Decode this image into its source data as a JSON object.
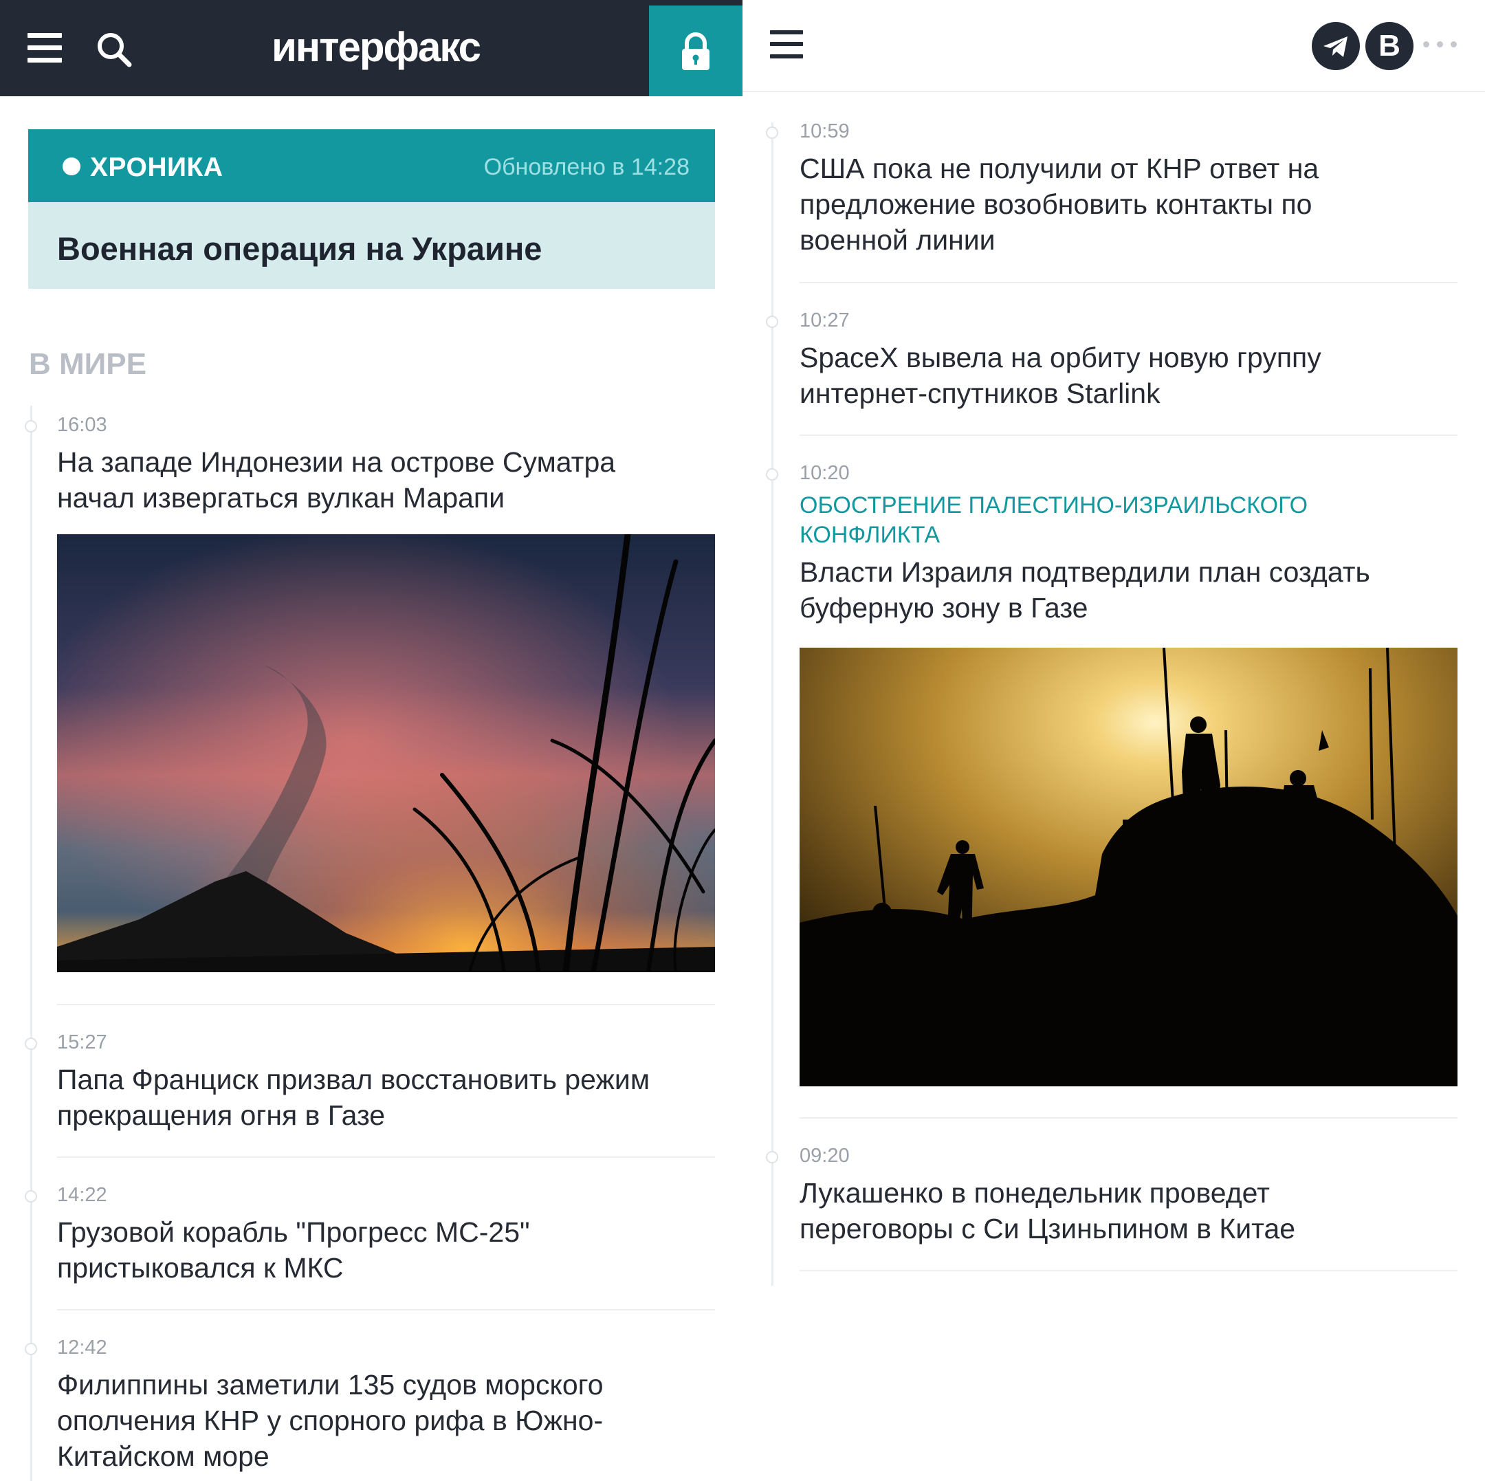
{
  "left": {
    "header": {
      "logo_text": "интерфакс",
      "menu_icon": "hamburger-menu-icon",
      "search_icon": "search-icon",
      "lock_icon": "lock-icon",
      "bg_color": "#232a36",
      "accent_color": "#14989f"
    },
    "chronicle": {
      "label": "ХРОНИКА",
      "updated": "Обновлено в 14:28",
      "title": "Военная операция на Украине"
    },
    "section_title": "В МИРЕ",
    "news": [
      {
        "time": "16:03",
        "title": "На западе Индонезии на острове Суматра начал извергаться вулкан Марапи",
        "has_image": true,
        "image": "volcano-sunset-photo"
      },
      {
        "time": "15:27",
        "title": "Папа Франциск призвал восстановить режим прекращения огня в Газе"
      },
      {
        "time": "14:22",
        "title": "Грузовой корабль \"Прогресс МС-25\" пристыковался к МКС"
      },
      {
        "time": "12:42",
        "title": "Филиппины заметили 135 судов морского ополчения КНР у спорного рифа в Южно-Китайском море"
      }
    ]
  },
  "right": {
    "header": {
      "menu_icon": "hamburger-menu-icon",
      "telegram_icon": "telegram-icon",
      "vk_label": "В",
      "more_icon": "more-dots-icon"
    },
    "news": [
      {
        "time": "10:59",
        "title": "США пока не получили от КНР ответ на предложение возобновить контакты по военной линии"
      },
      {
        "time": "10:27",
        "title": "SpaceX вывела на орбиту новую группу интернет-спутников Starlink"
      },
      {
        "time": "10:20",
        "topic": "ОБОСТРЕНИЕ ПАЛЕСТИНО-ИЗРАИЛЬСКОГО КОНФЛИКТА",
        "title": "Власти Израиля подтвердили план создать буферную зону в Газе",
        "has_image": true,
        "image": "soldiers-silhouette-photo"
      },
      {
        "time": "09:20",
        "title": "Лукашенко в понедельник проведет переговоры с Си Цзиньпином в Китае"
      }
    ]
  }
}
